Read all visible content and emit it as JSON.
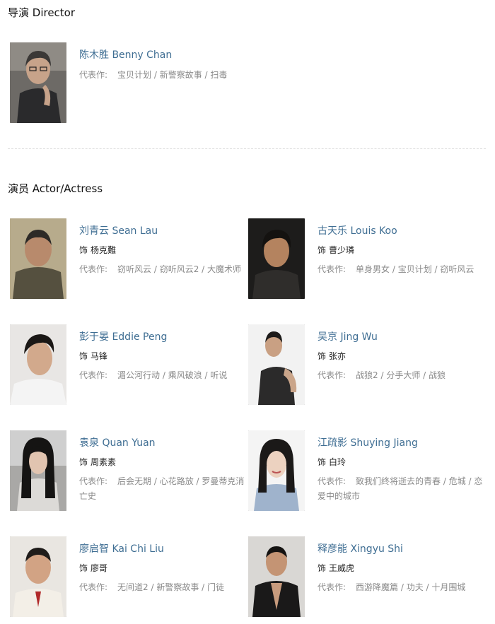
{
  "director_section": {
    "title": "导演 Director",
    "people": [
      {
        "name": "陈木胜 Benny Chan",
        "works_label": "代表作:",
        "works": "宝贝计划 / 新警察故事 / 扫毒"
      }
    ]
  },
  "actor_section": {
    "title": "演员 Actor/Actress",
    "people": [
      {
        "name": "刘青云 Sean Lau",
        "role_prefix": "饰",
        "role": "杨克難",
        "works_label": "代表作:",
        "works": "窃听风云 / 窃听风云2 / 大魔术师"
      },
      {
        "name": "古天乐 Louis Koo",
        "role_prefix": "饰",
        "role": "曹少璘",
        "works_label": "代表作:",
        "works": "单身男女 / 宝贝计划 / 窃听风云"
      },
      {
        "name": "彭于晏 Eddie Peng",
        "role_prefix": "饰",
        "role": "马锋",
        "works_label": "代表作:",
        "works": "湄公河行动 / 乘风破浪 / 听说"
      },
      {
        "name": "吴京 Jing Wu",
        "role_prefix": "饰",
        "role": "张亦",
        "works_label": "代表作:",
        "works": "战狼2 / 分手大师 / 战狼"
      },
      {
        "name": "袁泉 Quan Yuan",
        "role_prefix": "饰",
        "role": "周素素",
        "works_label": "代表作:",
        "works": "后会无期 / 心花路放 / 罗曼蒂克消亡史"
      },
      {
        "name": "江疏影 Shuying Jiang",
        "role_prefix": "饰",
        "role": "白玲",
        "works_label": "代表作:",
        "works": "致我们终将逝去的青春 / 危城 / 恋爱中的城市"
      },
      {
        "name": "廖启智 Kai Chi Liu",
        "role_prefix": "饰",
        "role": "廖哥",
        "works_label": "代表作:",
        "works": "无间道2 / 新警察故事 / 门徒"
      },
      {
        "name": "释彦能 Xingyu Shi",
        "role_prefix": "饰",
        "role": "王威虎",
        "works_label": "代表作:",
        "works": "西游降魔篇 / 功夫 / 十月围城"
      }
    ]
  },
  "colors": {
    "name_link": "#3f6e93",
    "works_text": "#8a8a8a",
    "divider": "#dcdcdc"
  }
}
